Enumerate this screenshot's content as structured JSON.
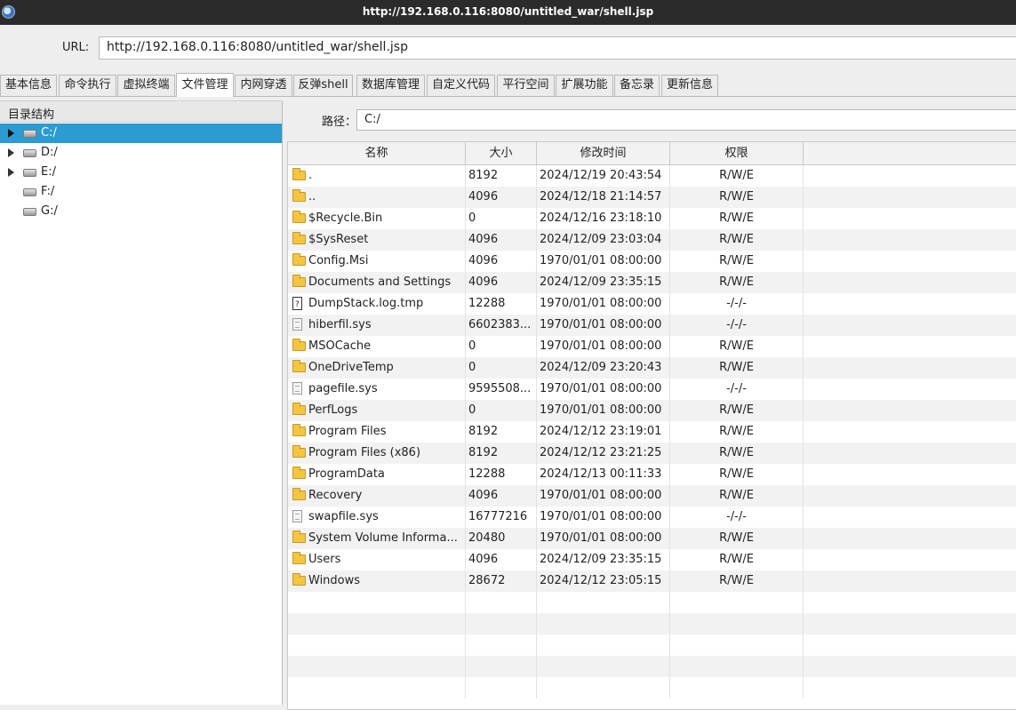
{
  "window": {
    "title": "http://192.168.0.116:8080/untitled_war/shell.jsp"
  },
  "url_bar": {
    "label": "URL:",
    "value": "http://192.168.0.116:8080/untitled_war/shell.jsp"
  },
  "tabs": [
    {
      "label": "基本信息"
    },
    {
      "label": "命令执行"
    },
    {
      "label": "虚拟终端"
    },
    {
      "label": "文件管理"
    },
    {
      "label": "内网穿透"
    },
    {
      "label": "反弹shell"
    },
    {
      "label": "数据库管理"
    },
    {
      "label": "自定义代码"
    },
    {
      "label": "平行空间"
    },
    {
      "label": "扩展功能"
    },
    {
      "label": "备忘录"
    },
    {
      "label": "更新信息"
    }
  ],
  "active_tab": "文件管理",
  "tree": {
    "header": "目录结构",
    "items": [
      {
        "label": "C:/",
        "icon": "drive-icon",
        "selected": true
      },
      {
        "label": "D:/",
        "icon": "drive-icon"
      },
      {
        "label": "E:/",
        "icon": "drive-icon"
      },
      {
        "label": "F:/",
        "icon": "drive-icon"
      },
      {
        "label": "G:/",
        "icon": "drive-icon"
      }
    ]
  },
  "path": {
    "label": "路径：",
    "value": "C:/"
  },
  "table": {
    "columns": [
      "名称",
      "大小",
      "修改时间",
      "权限"
    ],
    "rows": [
      {
        "name": ".",
        "size": "8192",
        "time": "2024/12/19 20:43:54",
        "perm": "R/W/E",
        "icon": "folder-icon"
      },
      {
        "name": "..",
        "size": "4096",
        "time": "2024/12/18 21:14:57",
        "perm": "R/W/E",
        "icon": "folder-icon"
      },
      {
        "name": "$Recycle.Bin",
        "size": "0",
        "time": "2024/12/16 23:18:10",
        "perm": "R/W/E",
        "icon": "folder-icon"
      },
      {
        "name": "$SysReset",
        "size": "4096",
        "time": "2024/12/09 23:03:04",
        "perm": "R/W/E",
        "icon": "folder-icon"
      },
      {
        "name": "Config.Msi",
        "size": "4096",
        "time": "1970/01/01 08:00:00",
        "perm": "R/W/E",
        "icon": "folder-icon"
      },
      {
        "name": "Documents and Settings",
        "size": "4096",
        "time": "2024/12/09 23:35:15",
        "perm": "R/W/E",
        "icon": "folder-icon"
      },
      {
        "name": "DumpStack.log.tmp",
        "size": "12288",
        "time": "1970/01/01 08:00:00",
        "perm": "-/-/-",
        "icon": "file-icon"
      },
      {
        "name": "hiberfil.sys",
        "size": "6602383...",
        "time": "1970/01/01 08:00:00",
        "perm": "-/-/-",
        "icon": "sys-file-icon"
      },
      {
        "name": "MSOCache",
        "size": "0",
        "time": "1970/01/01 08:00:00",
        "perm": "R/W/E",
        "icon": "folder-icon"
      },
      {
        "name": "OneDriveTemp",
        "size": "0",
        "time": "2024/12/09 23:20:43",
        "perm": "R/W/E",
        "icon": "folder-icon"
      },
      {
        "name": "pagefile.sys",
        "size": "9595508...",
        "time": "1970/01/01 08:00:00",
        "perm": "-/-/-",
        "icon": "sys-file-icon"
      },
      {
        "name": "PerfLogs",
        "size": "0",
        "time": "1970/01/01 08:00:00",
        "perm": "R/W/E",
        "icon": "folder-icon"
      },
      {
        "name": "Program Files",
        "size": "8192",
        "time": "2024/12/12 23:19:01",
        "perm": "R/W/E",
        "icon": "folder-icon"
      },
      {
        "name": "Program Files (x86)",
        "size": "8192",
        "time": "2024/12/12 23:21:25",
        "perm": "R/W/E",
        "icon": "folder-icon"
      },
      {
        "name": "ProgramData",
        "size": "12288",
        "time": "2024/12/13 00:11:33",
        "perm": "R/W/E",
        "icon": "folder-icon"
      },
      {
        "name": "Recovery",
        "size": "4096",
        "time": "1970/01/01 08:00:00",
        "perm": "R/W/E",
        "icon": "folder-icon"
      },
      {
        "name": "swapfile.sys",
        "size": "16777216",
        "time": "1970/01/01 08:00:00",
        "perm": "-/-/-",
        "icon": "sys-file-icon"
      },
      {
        "name": "System Volume Informa...",
        "size": "20480",
        "time": "1970/01/01 08:00:00",
        "perm": "R/W/E",
        "icon": "folder-icon"
      },
      {
        "name": "Users",
        "size": "4096",
        "time": "2024/12/09 23:35:15",
        "perm": "R/W/E",
        "icon": "folder-icon"
      },
      {
        "name": "Windows",
        "size": "28672",
        "time": "2024/12/12 23:05:15",
        "perm": "R/W/E",
        "icon": "folder-icon"
      }
    ]
  },
  "colors": {
    "selection": "#2b9bd1",
    "titlebar": "#2b2b2b",
    "folder": "#f4c542"
  }
}
